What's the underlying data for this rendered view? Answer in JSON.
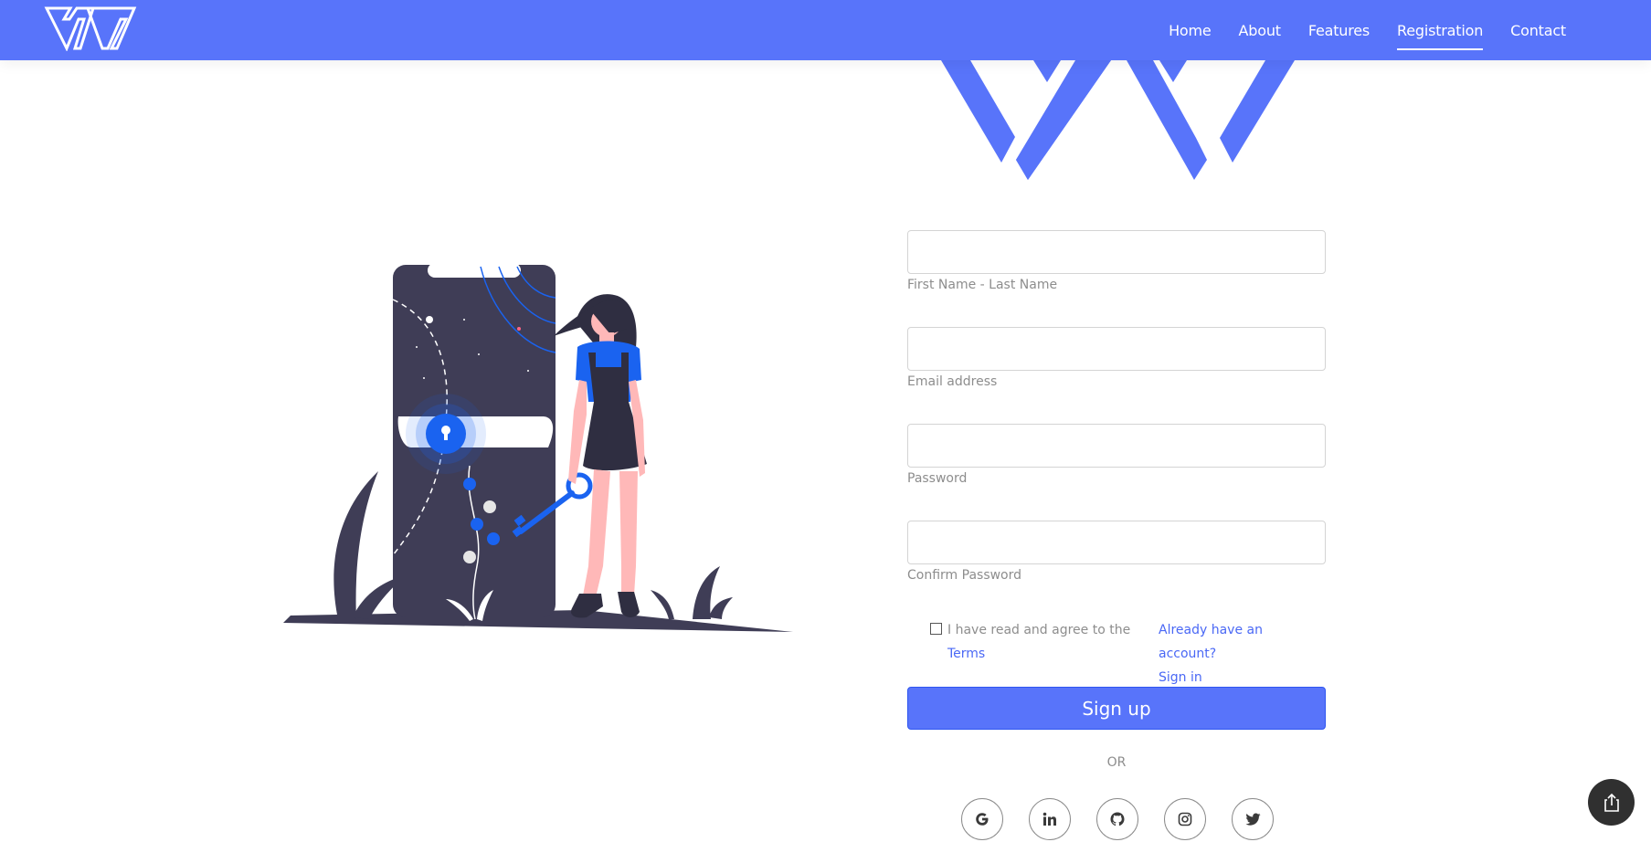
{
  "nav": {
    "links": [
      "Home",
      "About",
      "Features",
      "Registration",
      "Contact"
    ],
    "active": "Registration"
  },
  "form": {
    "fields": [
      {
        "hint": "First Name - Last Name",
        "value": ""
      },
      {
        "hint": "Email address",
        "value": ""
      },
      {
        "hint": "Password",
        "value": ""
      },
      {
        "hint": "Confirm Password",
        "value": ""
      }
    ],
    "terms_prefix": "I have read and agree to the",
    "terms_link": "Terms",
    "terms_checked": false,
    "already_account": "Already have an account?",
    "sign_in": "Sign in",
    "signup_label": "Sign up",
    "or_label": "OR"
  },
  "socials": [
    "google-icon",
    "linkedin-icon",
    "github-icon",
    "instagram-icon",
    "twitter-icon"
  ],
  "colors": {
    "brand": "#5874fa",
    "link": "#4a68f5",
    "illustration_dark": "#3f3d56",
    "illustration_blue": "#1a63f0",
    "skin": "#ffb8b8"
  }
}
